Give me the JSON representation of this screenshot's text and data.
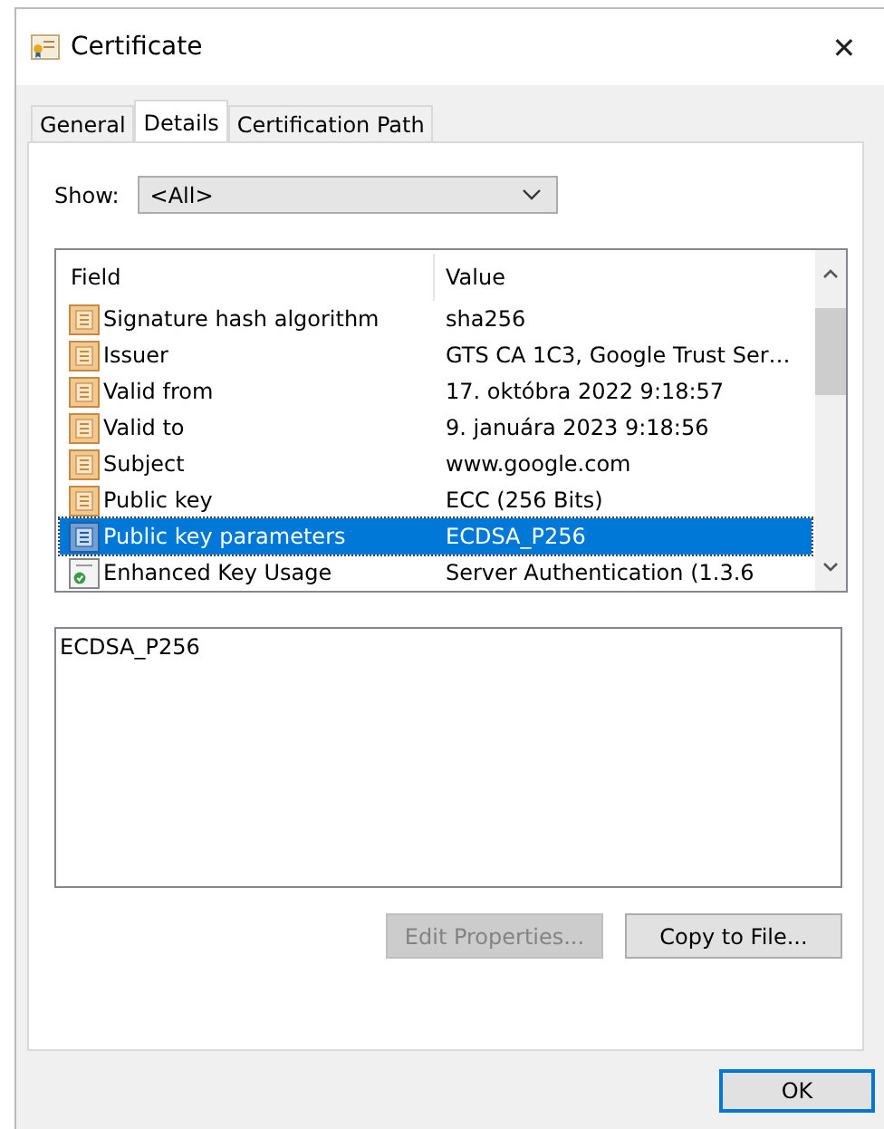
{
  "window": {
    "title": "Certificate",
    "close": "✕"
  },
  "tabs": [
    {
      "label": "General",
      "selected": false
    },
    {
      "label": "Details",
      "selected": true
    },
    {
      "label": "Certification Path",
      "selected": false
    }
  ],
  "show": {
    "label": "Show:",
    "value": "<All>"
  },
  "table": {
    "columns": [
      "Field",
      "Value"
    ],
    "rows": [
      {
        "kind": "property",
        "field": "Signature hash algorithm",
        "value": "sha256",
        "selected": false
      },
      {
        "kind": "property",
        "field": "Issuer",
        "value": "GTS CA 1C3, Google Trust Ser…",
        "selected": false
      },
      {
        "kind": "property",
        "field": "Valid from",
        "value": "17. októbra 2022 9:18:57",
        "selected": false
      },
      {
        "kind": "property",
        "field": "Valid to",
        "value": "9. januára 2023 9:18:56",
        "selected": false
      },
      {
        "kind": "property",
        "field": "Subject",
        "value": "www.google.com",
        "selected": false
      },
      {
        "kind": "property",
        "field": "Public key",
        "value": "ECC (256 Bits)",
        "selected": false
      },
      {
        "kind": "property",
        "field": "Public key parameters",
        "value": "ECDSA_P256",
        "selected": true
      },
      {
        "kind": "extension",
        "field": "Enhanced Key Usage",
        "value": "Server Authentication (1.3.6",
        "selected": false
      }
    ]
  },
  "detail_text": "ECDSA_P256",
  "actions": [
    {
      "label": "Edit Properties...",
      "disabled": true
    },
    {
      "label": "Copy to File...",
      "disabled": false
    }
  ],
  "footer": [
    {
      "label": "OK",
      "default": true
    }
  ]
}
